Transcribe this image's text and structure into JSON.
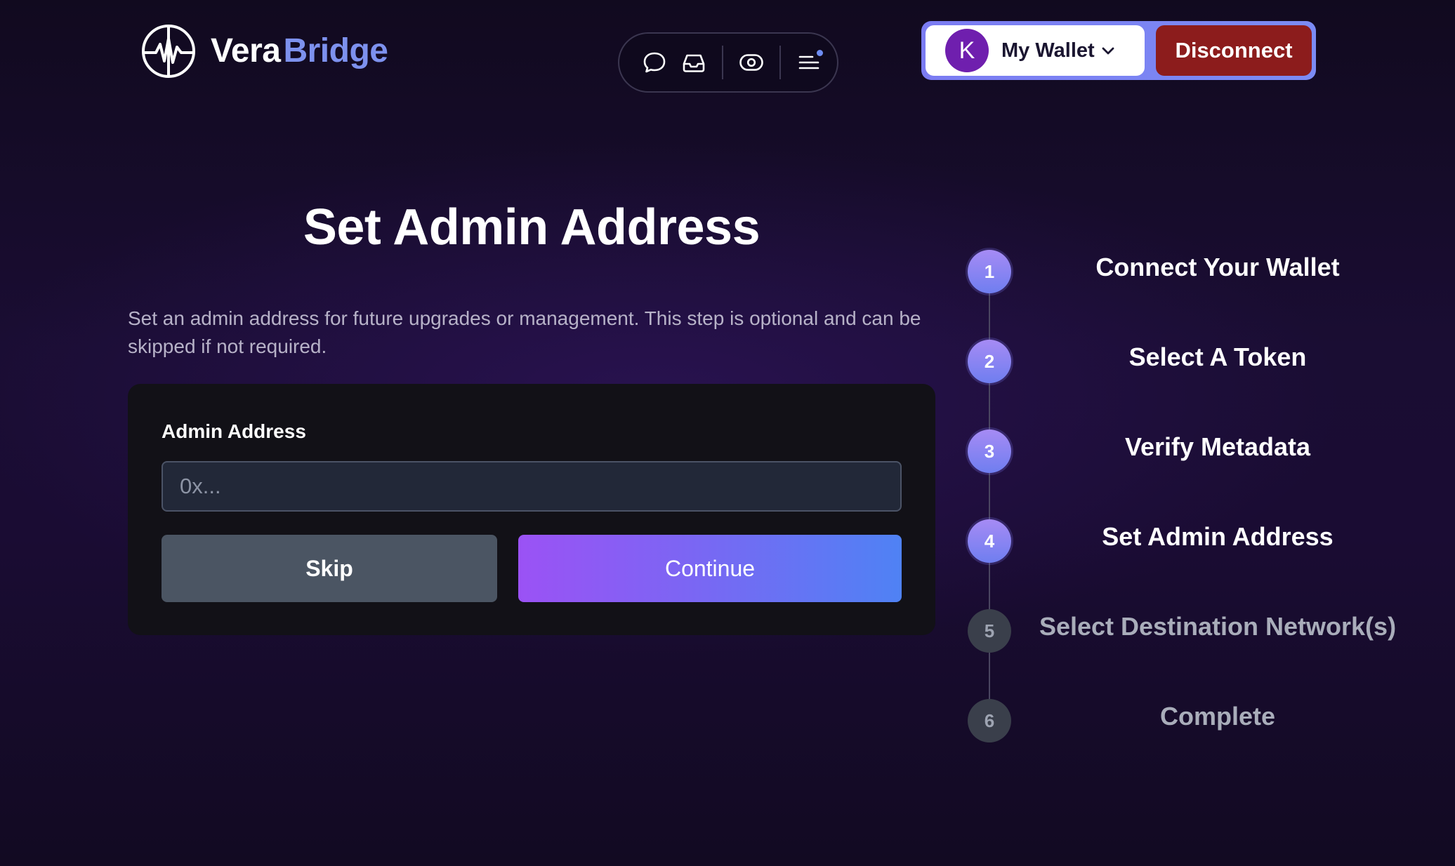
{
  "header": {
    "logo": {
      "part1": "Vera",
      "part2": "Bridge",
      "icon": "pulse-globe-icon"
    },
    "nav_icons": [
      "chat-bubble-icon",
      "inbox-icon",
      "eye-toggle-icon",
      "menu-icon"
    ],
    "wallet": {
      "avatar_initial": "K",
      "label": "My Wallet",
      "icon": "chevron-down-icon"
    },
    "disconnect_label": "Disconnect"
  },
  "main": {
    "title": "Set Admin Address",
    "description": "Set an admin address for future upgrades or management. This step is optional and can be skipped if not required.",
    "form": {
      "label": "Admin Address",
      "value": "",
      "placeholder": "0x...",
      "skip_label": "Skip",
      "continue_label": "Continue"
    }
  },
  "steps": [
    {
      "number": "1",
      "label": "Connect Your Wallet",
      "active": true
    },
    {
      "number": "2",
      "label": "Select A Token",
      "active": true
    },
    {
      "number": "3",
      "label": "Verify Metadata",
      "active": true
    },
    {
      "number": "4",
      "label": "Set Admin Address",
      "active": true
    },
    {
      "number": "5",
      "label": "Select Destination Network(s)",
      "active": false
    },
    {
      "number": "6",
      "label": "Complete",
      "active": false
    }
  ],
  "colors": {
    "accent": "#7d91ee",
    "disconnect": "#8c1c1c",
    "continue_start": "#9b52f5",
    "continue_end": "#4f82f4",
    "avatar": "#6f1fae"
  }
}
